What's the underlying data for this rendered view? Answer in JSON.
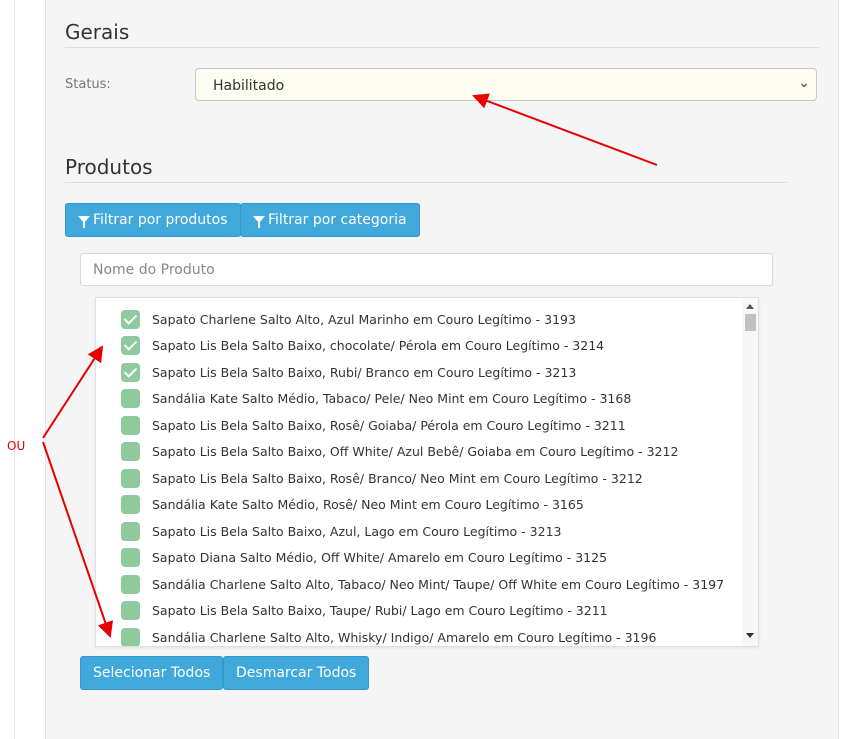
{
  "sections": {
    "general_title": "Gerais",
    "products_title": "Produtos"
  },
  "status": {
    "label": "Status:",
    "selected": "Habilitado"
  },
  "filters": {
    "by_products": "Filtrar por produtos",
    "by_category": "Filtrar por categoria"
  },
  "search": {
    "placeholder": "Nome do Produto",
    "value": ""
  },
  "products": [
    {
      "label": "Sapato Charlene Salto Alto, Azul Marinho em Couro Legítimo - 3193",
      "checked": true
    },
    {
      "label": "Sapato Lis Bela Salto Baixo, chocolate/ Pérola em Couro Legítimo - 3214",
      "checked": true
    },
    {
      "label": "Sapato Lis Bela Salto Baixo, Rubi/ Branco em Couro Legítimo - 3213",
      "checked": true
    },
    {
      "label": "Sandália Kate Salto Médio, Tabaco/ Pele/ Neo Mint em Couro Legítimo - 3168",
      "checked": false
    },
    {
      "label": "Sapato Lis Bela Salto Baixo, Rosê/ Goiaba/ Pérola em Couro Legítimo - 3211",
      "checked": false
    },
    {
      "label": "Sapato Lis Bela Salto Baixo, Off White/ Azul Bebê/ Goiaba em Couro Legítimo - 3212",
      "checked": false
    },
    {
      "label": "Sapato Lis Bela Salto Baixo, Rosê/ Branco/ Neo Mint em Couro Legítimo - 3212",
      "checked": false
    },
    {
      "label": "Sandália Kate Salto Médio, Rosê/ Neo Mint em Couro Legítimo - 3165",
      "checked": false
    },
    {
      "label": "Sapato Lis Bela Salto Baixo, Azul, Lago em Couro Legítimo - 3213",
      "checked": false
    },
    {
      "label": "Sapato Diana Salto Médio, Off White/ Amarelo em Couro Legítimo - 3125",
      "checked": false
    },
    {
      "label": "Sandália Charlene Salto Alto, Tabaco/ Neo Mint/ Taupe/ Off White em Couro Legítimo - 3197",
      "checked": false
    },
    {
      "label": "Sapato Lis Bela Salto Baixo, Taupe/ Rubi/ Lago em Couro Legítimo - 3211",
      "checked": false
    },
    {
      "label": "Sandália Charlene Salto Alto, Whisky/ Indigo/ Amarelo em Couro Legítimo - 3196",
      "checked": false
    }
  ],
  "actions": {
    "select_all": "Selecionar Todos",
    "deselect_all": "Desmarcar Todos"
  },
  "annotation": {
    "text": "OU",
    "color": "#e60000"
  },
  "colors": {
    "button": "#41a8dc",
    "checkbox": "#8fca9f",
    "arrow": "#e60000"
  }
}
